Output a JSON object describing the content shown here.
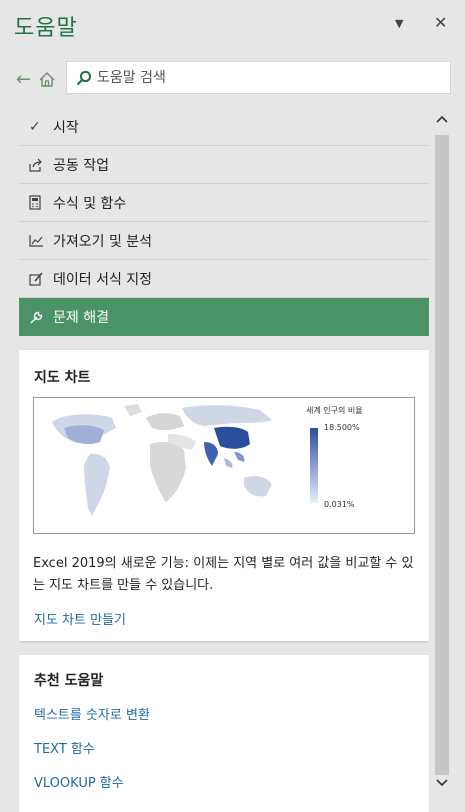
{
  "panel": {
    "title": "도움말",
    "dropdown_icon": "▼",
    "close_icon": "✕"
  },
  "search": {
    "placeholder": "도움말 검색"
  },
  "menu": {
    "items": [
      {
        "label": "시작",
        "icon": "checkmark-icon"
      },
      {
        "label": "공동 작업",
        "icon": "share-icon"
      },
      {
        "label": "수식 및 함수",
        "icon": "calculator-icon"
      },
      {
        "label": "가져오기 및 분석",
        "icon": "chart-icon"
      },
      {
        "label": "데이터 서식 지정",
        "icon": "format-icon"
      },
      {
        "label": "문제 해결",
        "icon": "wrench-icon",
        "active": true
      }
    ]
  },
  "feature_card": {
    "title": "지도 차트",
    "legend_title": "세계 인구의 비율",
    "legend_max": "18.500%",
    "legend_min": "0.031%",
    "description": "Excel 2019의 새로운 기능: 이제는 지역 별로 여러 값을 비교할 수 있는 지도 차트를 만들 수 있습니다.",
    "link": "지도 차트 만들기"
  },
  "recommended": {
    "title": "추천 도움말",
    "links": [
      "텍스트를 숫자로 변환",
      "TEXT 함수",
      "VLOOKUP 함수"
    ]
  },
  "colors": {
    "accent": "#217346",
    "active_item": "#4a9366",
    "link": "#1e6aa8",
    "map_high": "#2b4f9e",
    "map_low": "#e8eefa"
  }
}
